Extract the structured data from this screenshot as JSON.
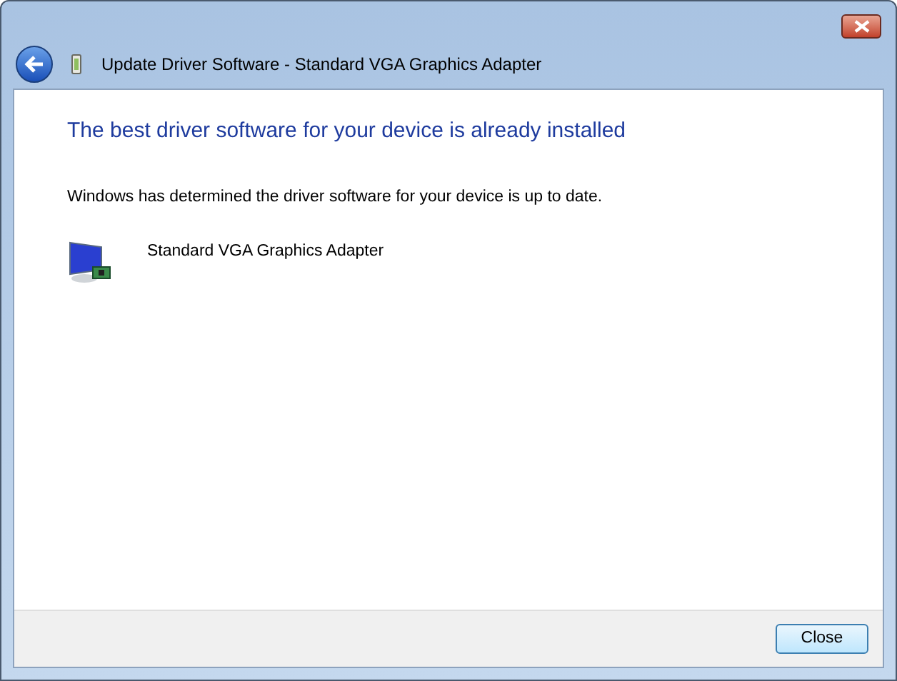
{
  "window": {
    "title": "Update Driver Software - Standard VGA Graphics Adapter"
  },
  "heading": "The best driver software for your device is already installed",
  "message": "Windows has determined the driver software for your device is up to date.",
  "device": {
    "name": "Standard VGA Graphics Adapter"
  },
  "buttons": [
    "Close"
  ]
}
